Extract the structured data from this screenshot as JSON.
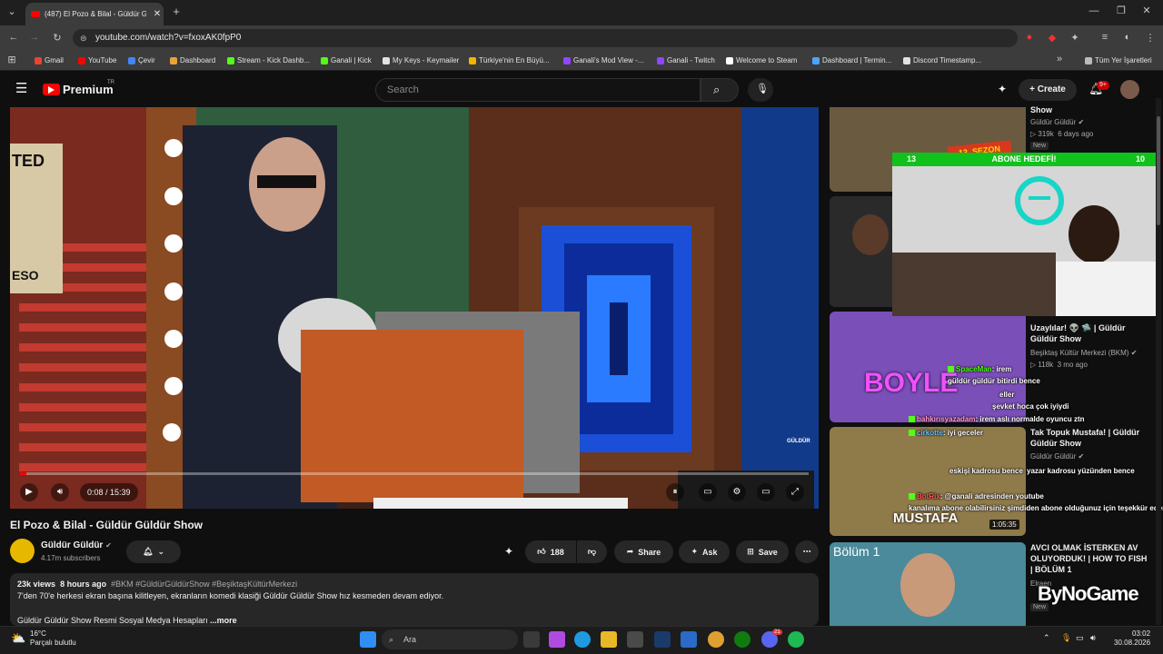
{
  "browser": {
    "tab_title": "(487) El Pozo & Bilal - Güldür Gü...",
    "tab_close": "✕",
    "new_tab": "+",
    "url": "youtube.com/watch?v=fxoxAK0fpP0",
    "bookmarks": [
      "Gmail",
      "YouTube",
      "Çevir",
      "Dashboard",
      "Stream - Kick Dashb...",
      "Ganali | Kick",
      "My Keys - Keymailer",
      "Türkiye'nin En Büyü...",
      "Ganali's Mod View -...",
      "Ganali - Twitch",
      "Welcome to Steam",
      "Dashboard | Termin...",
      "Discord Timestamp..."
    ],
    "bookmark_colors": [
      "#ea4335",
      "#ff0000",
      "#4285f4",
      "#e8a33d",
      "#53fc18",
      "#53fc18",
      "#e2e2e2",
      "#f4b400",
      "#9146ff",
      "#9146ff",
      "#ffffff",
      "#4da3ff",
      "#e2e2e2"
    ],
    "all_bookmarks": "Tüm Yer İşaretleri"
  },
  "youtube": {
    "logo_text": "Premium",
    "logo_sup": "TR",
    "search_placeholder": "Search",
    "create_label": "Create",
    "notif_badge": "9+"
  },
  "video": {
    "time": "0:08 / 15:39",
    "progress": 0.0085,
    "title": "El Pozo & Bilal - Güldür Güldür Show",
    "channel": "Güldür Güldür",
    "subscribers": "4.17m subscribers",
    "likes": "188",
    "share": "Share",
    "ask": "Ask",
    "save": "Save",
    "views": "23k views",
    "age": "8 hours ago",
    "hashtags": "#BKM #GüldürGüldürShow #BeşiktaşKültürMerkezi",
    "desc_line": "7'den 70'e herkesi ekran başına kilitleyen, ekranların komedi klasiği Güldür Güldür Show hız kesmeden devam ediyor.",
    "desc_more_prefix": "Güldür Güldür Show Resmi Sosyal Medya Hesapları",
    "more": "...more",
    "corner_logo": "GÜLDÜR"
  },
  "recommendations": [
    {
      "title": "Show",
      "channel": "Güldür Güldür",
      "views": "319k",
      "age": "6 days ago",
      "badge": "New",
      "thumb_text": "13. SEZON"
    },
    {
      "title": "",
      "channel": "",
      "views": "",
      "age": ""
    },
    {
      "title": "Uzaylılar! 👽 🛸 | Güldür Güldür Show",
      "channel": "Beşiktaş Kültür Merkezi (BKM)",
      "views": "118k",
      "age": "3 mo ago",
      "thumb_text": "BOYLE"
    },
    {
      "title": "Tak Topuk Mustafa! | Güldür Güldür Show",
      "channel": "Güldür Güldür",
      "duration": "1:05:35",
      "thumb_text": "MUSTAFA"
    },
    {
      "title": "AVCI OLMAK İSTERKEN AV OLUYORDUK! | HOW TO FISH | BÖLÜM 1",
      "channel": "Elraen",
      "badge": "New",
      "thumb_text": "Bölüm 1"
    }
  ],
  "overlay": {
    "abone_label": "ABONE HEDEFİ!",
    "abone_left": "13",
    "abone_right": "10",
    "chat": [
      {
        "user": "SpaceMan",
        "msg": "irem"
      },
      {
        "user": "",
        "msg": "güldür güldür bitirdi bence"
      },
      {
        "user": "",
        "msg": "eller"
      },
      {
        "user": "",
        "msg": "şevket hoca çok iyiydi"
      },
      {
        "user": "bahkırısyazadam",
        "msg": "irem aslı normalde oyuncu ztn"
      },
      {
        "user": "cirkotte",
        "msg": "iyi geceler"
      },
      {
        "user": "",
        "msg": "eskişi kadrosu bence"
      },
      {
        "user": "",
        "msg": "yazar kadrosu yüzünden bence"
      },
      {
        "user": "BotRix",
        "msg": "@ganali adresinden youtube"
      },
      {
        "user": "",
        "msg": "kanalıma abone olabilirsiniz şimdiden abone olduğunuz için teşekkür ederim."
      }
    ],
    "watermark": "ByNoGame"
  },
  "taskbar": {
    "temp": "16°C",
    "weather": "Parçalı bulutlu",
    "search": "Ara",
    "time": "03:02",
    "date": "30.08.2026",
    "discord_badge": "21"
  }
}
